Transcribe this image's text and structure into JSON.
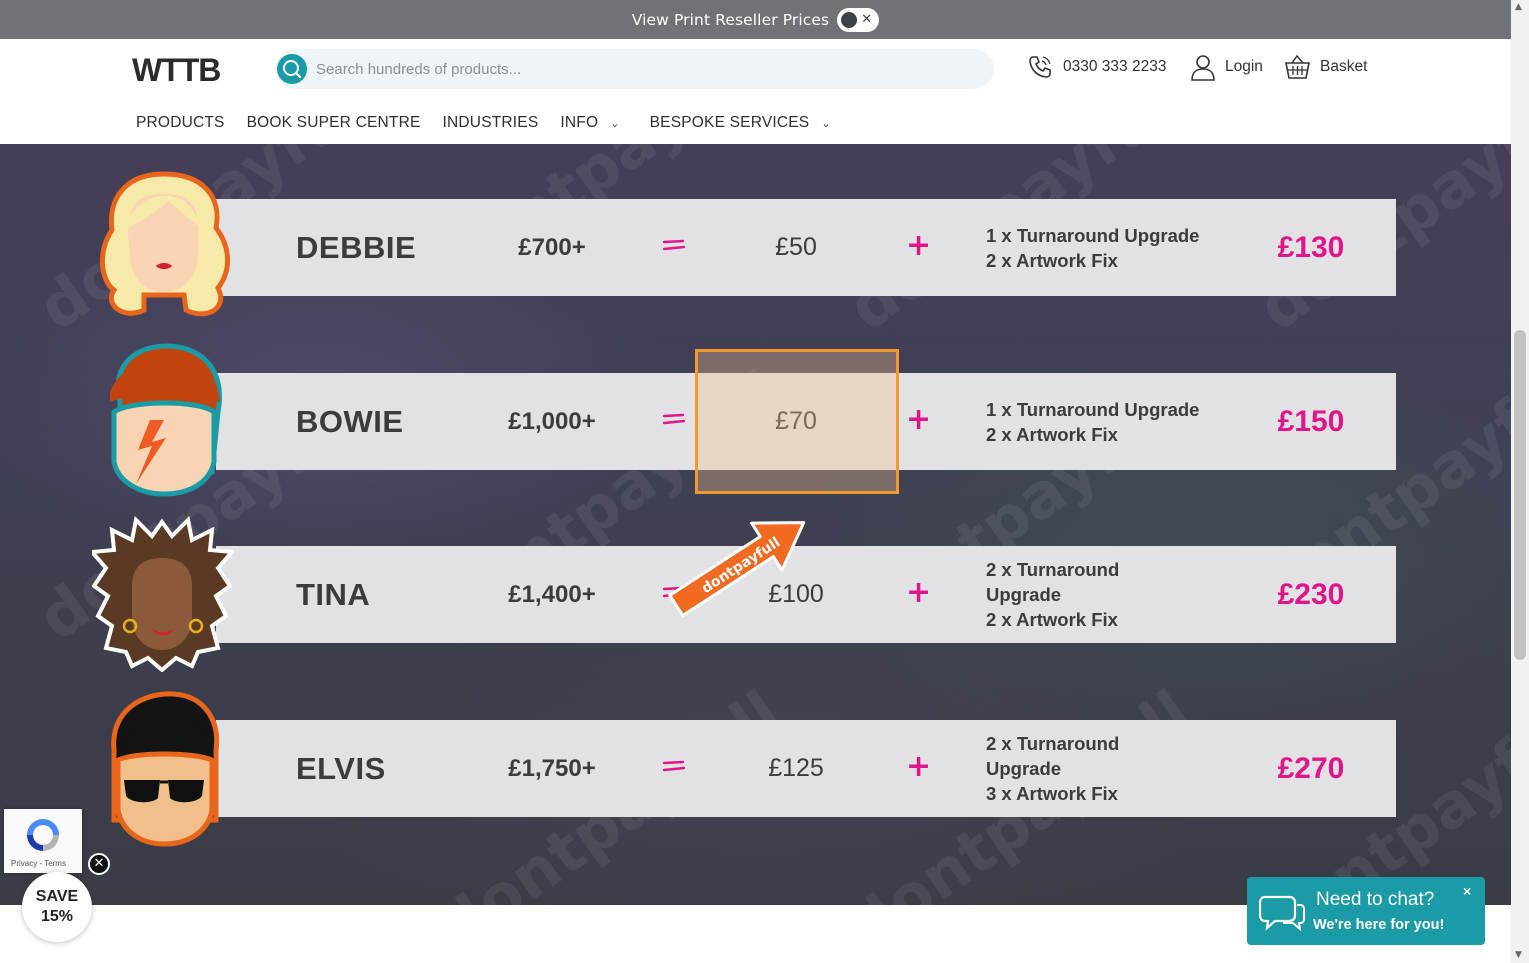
{
  "reseller_bar": {
    "label": "View Print Reseller Prices"
  },
  "search": {
    "placeholder": "Search hundreds of products..."
  },
  "header": {
    "phone": "0330 333 2233",
    "login": "Login",
    "basket": "Basket"
  },
  "nav": {
    "items": [
      {
        "label": "PRODUCTS",
        "has_dropdown": false
      },
      {
        "label": "BOOK SUPER CENTRE",
        "has_dropdown": false
      },
      {
        "label": "INDUSTRIES",
        "has_dropdown": false
      },
      {
        "label": "INFO",
        "has_dropdown": true
      },
      {
        "label": "BESPOKE SERVICES",
        "has_dropdown": true
      }
    ]
  },
  "tiers": [
    {
      "name": "DEBBIE",
      "spend": "£700+",
      "credit": "£50",
      "extras": [
        "1 x Turnaround Upgrade",
        "2 x Artwork Fix"
      ],
      "total": "£130"
    },
    {
      "name": "BOWIE",
      "spend": "£1,000+",
      "credit": "£70",
      "extras": [
        "1 x Turnaround Upgrade",
        "2 x Artwork Fix"
      ],
      "total": "£150"
    },
    {
      "name": "TINA",
      "spend": "£1,400+",
      "credit": "£100",
      "extras": [
        "2 x Turnaround",
        "Upgrade",
        "2 x Artwork Fix"
      ],
      "total": "£230"
    },
    {
      "name": "ELVIS",
      "spend": "£1,750+",
      "credit": "£125",
      "extras": [
        "2 x Turnaround",
        "Upgrade",
        "3 x Artwork Fix"
      ],
      "total": "£270"
    }
  ],
  "annotation": {
    "arrow_text": "dontpayfull",
    "highlighted_tier": "BOWIE"
  },
  "recaptcha": {
    "links": "Privacy - Terms"
  },
  "save_badge": {
    "line1": "SAVE",
    "line2": "15%"
  },
  "chat": {
    "title": "Need to chat?",
    "subtitle": "We're here for you!",
    "close": "×"
  },
  "watermark": "dontpayfull",
  "colors": {
    "accent_pink": "#e0158c",
    "teal": "#1a9ba5",
    "highlight_orange": "#f39a2c"
  }
}
